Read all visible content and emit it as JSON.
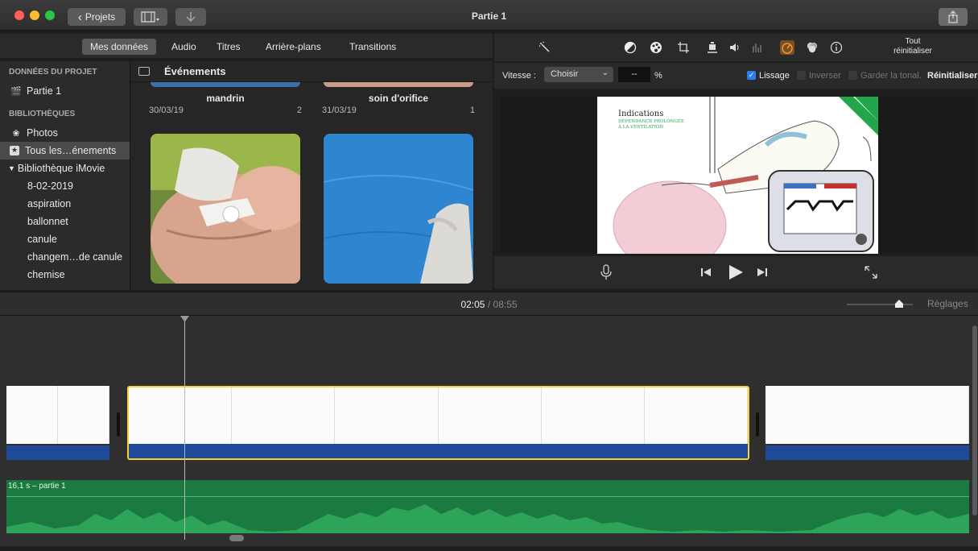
{
  "window": {
    "title": "Partie 1"
  },
  "toolbar": {
    "projects_label": "Projets",
    "back_glyph": "‹"
  },
  "browser_tabs": [
    {
      "label": "Mes données",
      "active": true
    },
    {
      "label": "Audio",
      "active": false
    },
    {
      "label": "Titres",
      "active": false
    },
    {
      "label": "Arrière-plans",
      "active": false
    },
    {
      "label": "Transitions",
      "active": false
    }
  ],
  "sidebar": {
    "project_header": "DONNÉES DU PROJET",
    "project_item": "Partie 1",
    "libraries_header": "BIBLIOTHÈQUES",
    "photos": "Photos",
    "all_events": "Tous les…énements",
    "library": "Bibliothèque iMovie",
    "events": [
      "8-02-2019",
      "aspiration",
      "ballonnet",
      "canule",
      "changem…de canule",
      "chemise"
    ]
  },
  "events_browser": {
    "title": "Événements",
    "cards": [
      {
        "name": "mandrin",
        "date": "30/03/19",
        "count": "2"
      },
      {
        "name": "soin d'orifice",
        "date": "31/03/19",
        "count": "1"
      }
    ]
  },
  "adjustments": {
    "reset_all": "Tout réinitialiser"
  },
  "speed": {
    "label": "Vitesse :",
    "selected": "Choisir",
    "value": "--",
    "unit": "%",
    "smoothing": "Lissage",
    "reverse": "Inverser",
    "keep_pitch": "Garder la tonal.",
    "reset": "Réinitialiser"
  },
  "viewer_slide": {
    "title": "Indications",
    "subtitle_1": "DÉPENDANCE PROLONGÉE",
    "subtitle_2": "À LA VENTILATION"
  },
  "timeline": {
    "current": "02:05",
    "separator": "/",
    "total": "08:55",
    "settings": "Réglages",
    "audio_label": "16,1 s – partie 1"
  },
  "colors": {
    "accent_orange": "#ff9f2e",
    "selection_yellow": "#f5d23c",
    "audio_green": "#1a7a3f",
    "clip_blue": "#1e4a99",
    "slide_green": "#23a64b"
  }
}
